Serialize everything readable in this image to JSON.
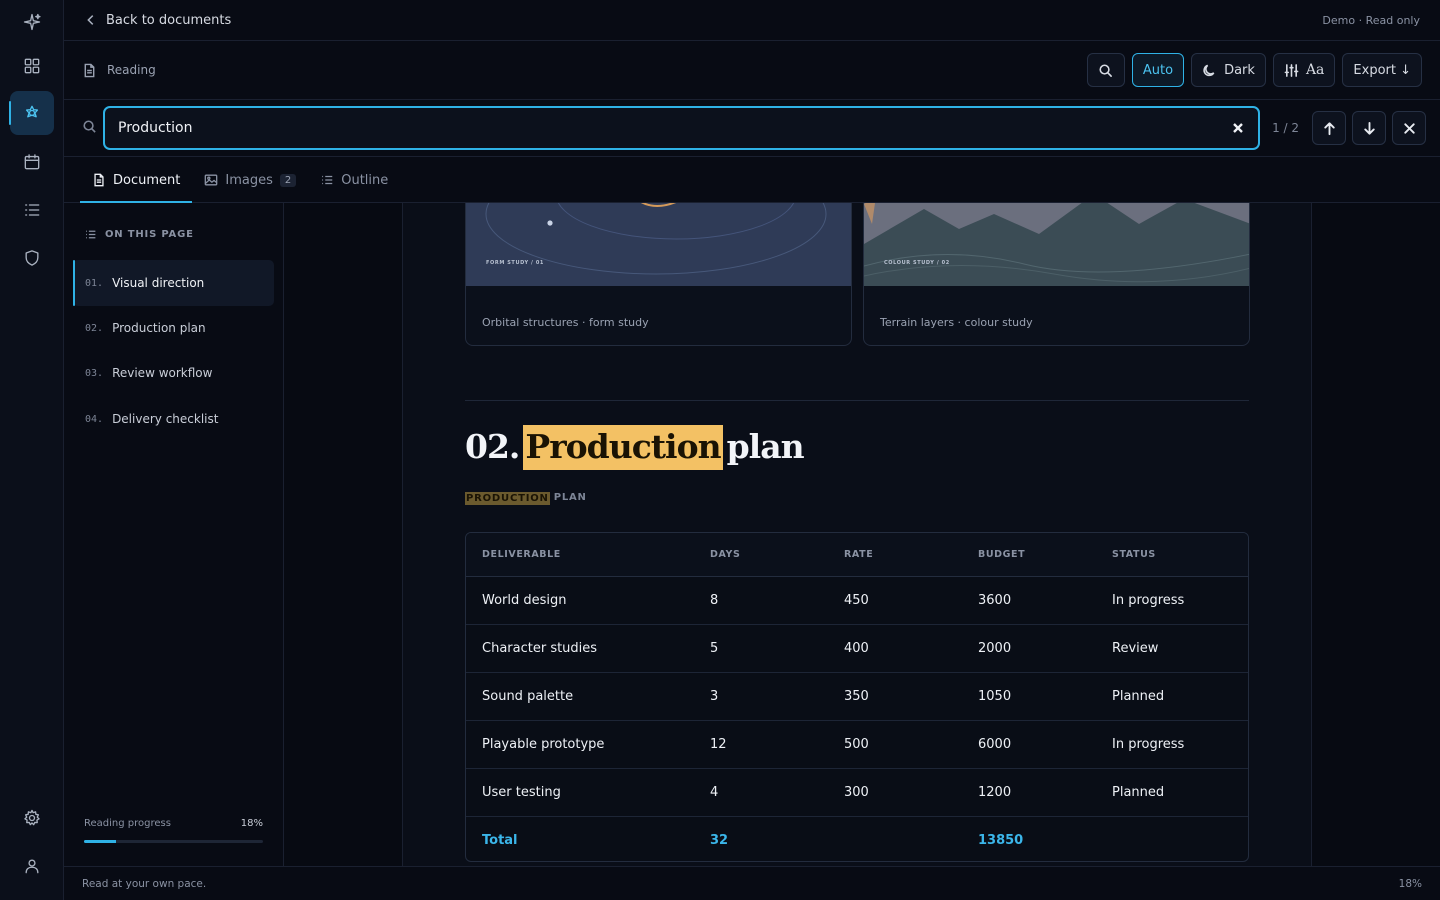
{
  "topbar": {
    "back_label": "Back to documents",
    "mode_label": "Demo · Read only"
  },
  "toolbar": {
    "reading_label": "Reading",
    "auto_label": "Auto",
    "dark_label": "Dark",
    "font_label": "Aa",
    "export_label": "Export ↓"
  },
  "search": {
    "value": "Production",
    "count": "1 / 2"
  },
  "tabs": [
    {
      "label": "Document",
      "active": true
    },
    {
      "label": "Images",
      "badge": "2"
    },
    {
      "label": "Outline"
    }
  ],
  "toc": {
    "heading": "ON THIS PAGE",
    "items": [
      {
        "num": "01.",
        "label": "Visual direction",
        "active": true
      },
      {
        "num": "02.",
        "label": "Production plan"
      },
      {
        "num": "03.",
        "label": "Review workflow"
      },
      {
        "num": "04.",
        "label": "Delivery checklist"
      }
    ],
    "progress_label": "Reading progress",
    "progress_value": "18%",
    "progress_fraction": 0.18
  },
  "cards": [
    {
      "caption": "Orbital structures · form study",
      "tag": "FORM STUDY / 01"
    },
    {
      "caption": "Terrain layers · colour study",
      "tag": "COLOUR STUDY / 02"
    }
  ],
  "section": {
    "number": "02.",
    "highlight": "Production",
    "rest": "plan",
    "eyebrow_highlight": "PRODUCTION",
    "eyebrow_rest": "PLAN"
  },
  "table": {
    "headers": [
      "DELIVERABLE",
      "DAYS",
      "RATE",
      "BUDGET",
      "STATUS"
    ],
    "rows": [
      [
        "World design",
        "8",
        "450",
        "3600",
        "In progress"
      ],
      [
        "Character studies",
        "5",
        "400",
        "2000",
        "Review"
      ],
      [
        "Sound palette",
        "3",
        "350",
        "1050",
        "Planned"
      ],
      [
        "Playable prototype",
        "12",
        "500",
        "6000",
        "In progress"
      ],
      [
        "User testing",
        "4",
        "300",
        "1200",
        "Planned"
      ]
    ],
    "total": [
      "Total",
      "32",
      "",
      "13850",
      ""
    ]
  },
  "statusbar": {
    "left": "Read at your own pace.",
    "right": "18%"
  },
  "colors": {
    "accent": "#2fb2e6",
    "highlight": "#f3c164"
  },
  "icons": [
    "sparkle-icon",
    "grid-icon",
    "flower-icon",
    "calendar-icon",
    "list-icon",
    "shield-icon",
    "gear-icon",
    "user-icon"
  ]
}
